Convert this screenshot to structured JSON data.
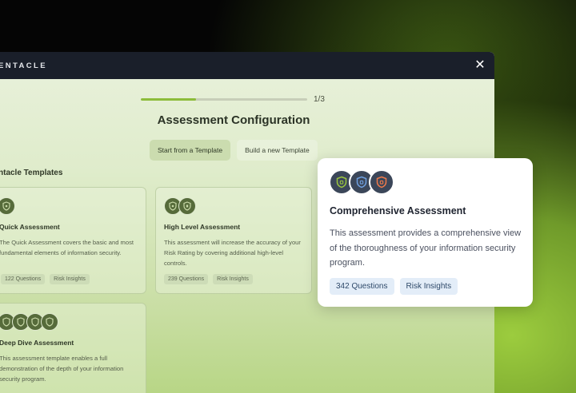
{
  "window": {
    "brand": "ENTACLE",
    "close_glyph": "✕"
  },
  "progress": {
    "label": "1/3",
    "fraction": 0.33
  },
  "config": {
    "title": "Assessment Configuration",
    "tabs": [
      {
        "label": "Start from a Template",
        "active": true
      },
      {
        "label": "Build a new Template",
        "active": false
      }
    ]
  },
  "templates": {
    "heading": "ntacle Templates",
    "cards": [
      {
        "name": "Quick Assessment",
        "description": "The Quick Assessment covers the basic and most fundamental elements of information security.",
        "tags": [
          "122 Questions",
          "Risk Insights"
        ],
        "icons": [
          "shield-icon"
        ]
      },
      {
        "name": "High Level Assessment",
        "description": "This assessment will increase the accuracy of your Risk Rating by covering additional high-level controls.",
        "tags": [
          "239 Questions",
          "Risk Insights"
        ],
        "icons": [
          "shield-icon",
          "shield-icon"
        ]
      },
      {
        "name": "Deep Dive Assessment",
        "description": "This assessment template enables a full demonstration of the depth of your information security program.",
        "tags": [],
        "icons": [
          "shield-icon",
          "shield-icon",
          "shield-icon",
          "shield-icon"
        ]
      }
    ]
  },
  "popover": {
    "title": "Comprehensive Assessment",
    "description": "This assessment provides a comprehensive view of the thoroughness of your information security program.",
    "tags": [
      "342 Questions",
      "Risk Insights"
    ],
    "icon_colors": [
      "#9bc63f",
      "#6fa0e0",
      "#f07a4a"
    ]
  },
  "colors": {
    "accent": "#8cbc3a",
    "titlebar": "#1a1f2a"
  }
}
